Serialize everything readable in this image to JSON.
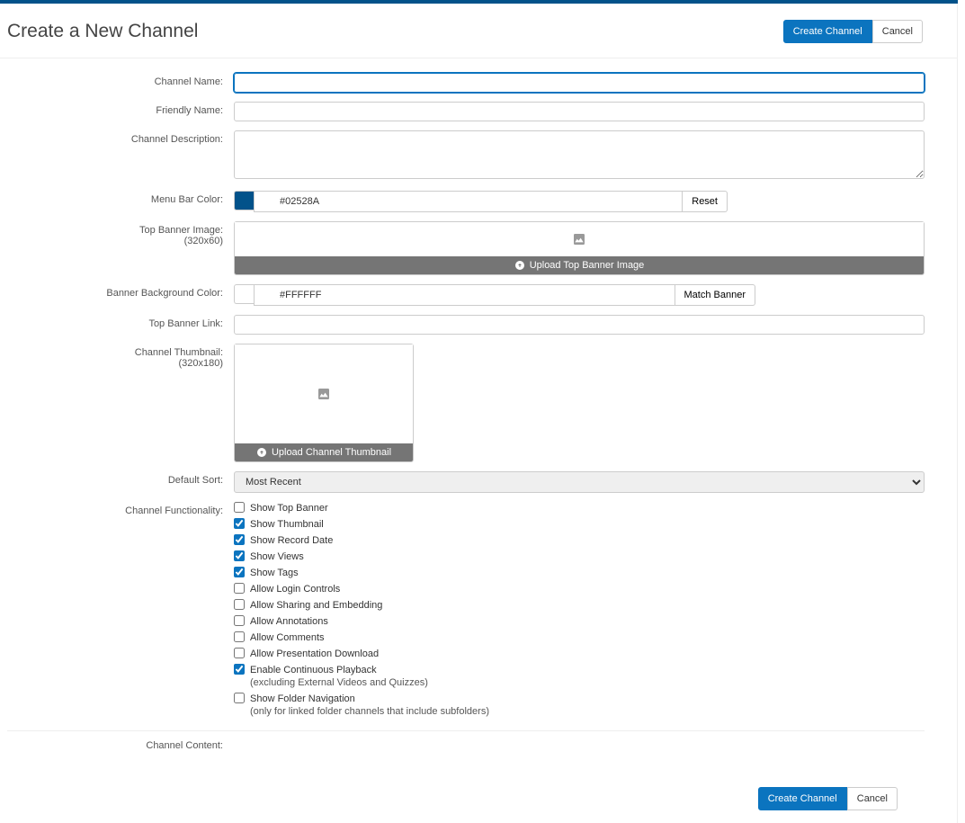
{
  "header": {
    "title": "Create a New Channel",
    "create_btn": "Create Channel",
    "cancel_btn": "Cancel"
  },
  "labels": {
    "channel_name": "Channel Name:",
    "friendly_name": "Friendly Name:",
    "channel_description": "Channel Description:",
    "menu_bar_color": "Menu Bar Color:",
    "top_banner_image": "Top Banner Image:",
    "top_banner_image_sub": "(320x60)",
    "banner_bg_color": "Banner Background Color:",
    "top_banner_link": "Top Banner Link:",
    "channel_thumbnail": "Channel Thumbnail:",
    "channel_thumbnail_sub": "(320x180)",
    "default_sort": "Default Sort:",
    "channel_functionality": "Channel Functionality:",
    "channel_content": "Channel Content:"
  },
  "values": {
    "channel_name": "",
    "friendly_name": "",
    "channel_description": "",
    "menu_bar_color": "#02528A",
    "banner_bg_color": "#FFFFFF",
    "top_banner_link": ""
  },
  "buttons": {
    "reset": "Reset",
    "match_banner": "Match Banner",
    "upload_top_banner": "Upload Top Banner Image",
    "upload_thumbnail": "Upload Channel Thumbnail"
  },
  "default_sort_options": [
    "Most Recent"
  ],
  "functionality": [
    {
      "label": "Show Top Banner",
      "checked": false,
      "note": ""
    },
    {
      "label": "Show Thumbnail",
      "checked": true,
      "note": ""
    },
    {
      "label": "Show Record Date",
      "checked": true,
      "note": ""
    },
    {
      "label": "Show Views",
      "checked": true,
      "note": ""
    },
    {
      "label": "Show Tags",
      "checked": true,
      "note": ""
    },
    {
      "label": "Allow Login Controls",
      "checked": false,
      "note": ""
    },
    {
      "label": "Allow Sharing and Embedding",
      "checked": false,
      "note": ""
    },
    {
      "label": "Allow Annotations",
      "checked": false,
      "note": ""
    },
    {
      "label": "Allow Comments",
      "checked": false,
      "note": ""
    },
    {
      "label": "Allow Presentation Download",
      "checked": false,
      "note": ""
    },
    {
      "label": "Enable Continuous Playback",
      "checked": true,
      "note": "(excluding External Videos and Quizzes)"
    },
    {
      "label": "Show Folder Navigation",
      "checked": false,
      "note": "(only for linked folder channels that include subfolders)"
    }
  ],
  "footer": {
    "create_btn": "Create Channel",
    "cancel_btn": "Cancel"
  }
}
